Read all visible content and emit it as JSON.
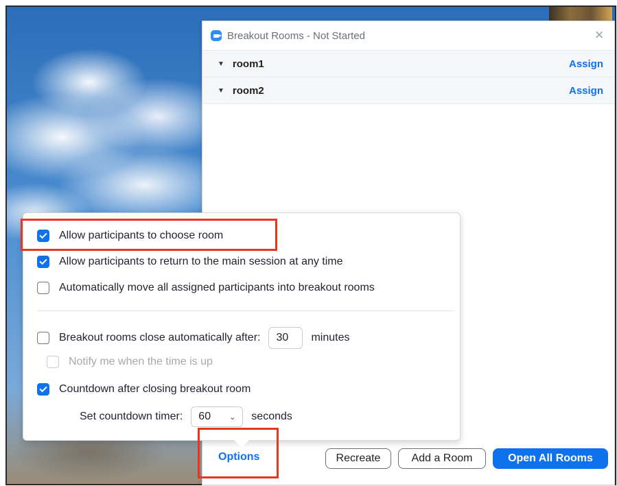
{
  "window": {
    "title": "Breakout Rooms - Not Started",
    "close_icon": "×",
    "rooms": [
      {
        "name": "room1",
        "action": "Assign"
      },
      {
        "name": "room2",
        "action": "Assign"
      }
    ]
  },
  "options_popup": {
    "allow_choose": "Allow participants to choose room",
    "allow_return": "Allow participants to return to the main session at any time",
    "auto_move": "Automatically move all assigned participants into breakout rooms",
    "close_auto": "Breakout rooms close automatically after:",
    "close_minutes_value": "30",
    "minutes_label": "minutes",
    "notify": "Notify me when the time is up",
    "countdown": "Countdown after closing breakout room",
    "set_timer_label": "Set countdown timer:",
    "timer_value": "60",
    "seconds_label": "seconds",
    "checked": {
      "allow_choose": true,
      "allow_return": true,
      "auto_move": false,
      "close_auto": false,
      "notify": false,
      "countdown": true
    }
  },
  "footer": {
    "options": "Options",
    "recreate": "Recreate",
    "add_room": "Add a Room",
    "open_all": "Open All Rooms"
  },
  "colors": {
    "accent": "#0e72ed",
    "highlight": "#e8351f"
  }
}
